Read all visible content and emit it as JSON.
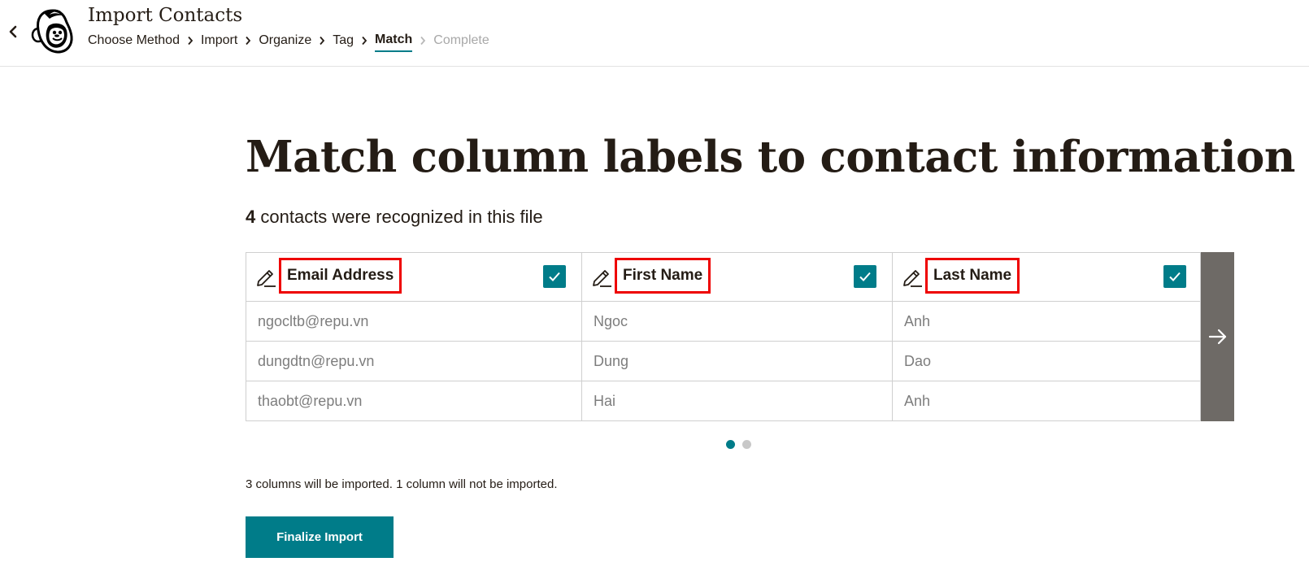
{
  "header": {
    "app_title": "Import Contacts",
    "back_icon": "chevron-left-icon",
    "logo_icon": "mailchimp-freddie-logo",
    "breadcrumbs": [
      {
        "label": "Choose Method",
        "state": "done"
      },
      {
        "label": "Import",
        "state": "done"
      },
      {
        "label": "Organize",
        "state": "done"
      },
      {
        "label": "Tag",
        "state": "done"
      },
      {
        "label": "Match",
        "state": "current"
      },
      {
        "label": "Complete",
        "state": "upcoming"
      }
    ]
  },
  "main": {
    "title": "Match column labels to contact information",
    "recognized": {
      "count": "4",
      "text": "contacts were recognized in this file"
    },
    "columns": [
      {
        "label": "Email Address",
        "checked": true,
        "values": [
          "ngocltb@repu.vn",
          "dungdtn@repu.vn",
          "thaobt@repu.vn"
        ]
      },
      {
        "label": "First Name",
        "checked": true,
        "values": [
          "Ngoc",
          "Dung",
          "Hai"
        ]
      },
      {
        "label": "Last Name",
        "checked": true,
        "values": [
          "Anh",
          "Dao",
          "Anh"
        ]
      }
    ],
    "pagination": {
      "current": 1,
      "total": 2
    },
    "summary": "3 columns will be imported. 1 column will not be imported.",
    "finalize_label": "Finalize Import"
  },
  "colors": {
    "accent": "#007c89",
    "highlight_border": "#ee0000",
    "next_panel": "#6e6a66",
    "text": "#241c15",
    "muted_text": "#7d7d7d"
  }
}
